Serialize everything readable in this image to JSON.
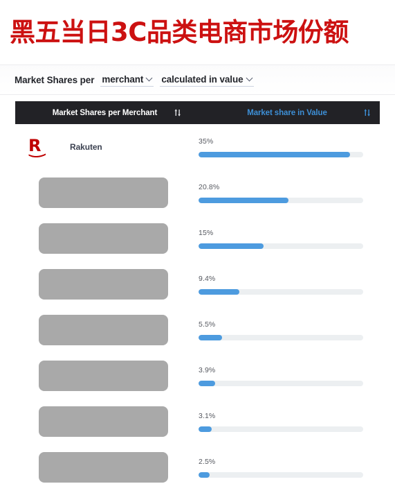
{
  "title": "黑五当日3C品类电商市场份额",
  "title_color": "#cc1111",
  "controls": {
    "prefix_label": "Market Shares per",
    "dimension_dropdown": "merchant",
    "metric_dropdown": "calculated in value"
  },
  "table": {
    "header": {
      "col_merchant": "Market Shares per Merchant",
      "col_value": "Market share in Value",
      "sort_icon": "sort-updown-icon",
      "active_color": "#3d8fd6",
      "background": "#222226"
    },
    "bar_color": "#4d9bdf",
    "bar_track_color": "#eceff1",
    "max_value": 35,
    "rows": [
      {
        "merchant": "Rakuten",
        "logo": "rakuten-r-logo",
        "redacted": false,
        "share": "35%",
        "value": 35.0
      },
      {
        "merchant": "",
        "logo": "",
        "redacted": true,
        "share": "20.8%",
        "value": 20.8
      },
      {
        "merchant": "",
        "logo": "",
        "redacted": true,
        "share": "15%",
        "value": 15.0
      },
      {
        "merchant": "",
        "logo": "",
        "redacted": true,
        "share": "9.4%",
        "value": 9.4
      },
      {
        "merchant": "",
        "logo": "",
        "redacted": true,
        "share": "5.5%",
        "value": 5.5
      },
      {
        "merchant": "",
        "logo": "",
        "redacted": true,
        "share": "3.9%",
        "value": 3.9
      },
      {
        "merchant": "",
        "logo": "",
        "redacted": true,
        "share": "3.1%",
        "value": 3.1
      },
      {
        "merchant": "",
        "logo": "",
        "redacted": true,
        "share": "2.5%",
        "value": 2.5
      }
    ]
  },
  "chart_data": {
    "type": "bar",
    "title": "黑五当日3C品类电商市场份额",
    "subtitle": "Market Shares per merchant calculated in value",
    "xlabel": "Market share in Value",
    "ylabel": "Merchant",
    "categories": [
      "Rakuten",
      "[redacted]",
      "[redacted]",
      "[redacted]",
      "[redacted]",
      "[redacted]",
      "[redacted]",
      "[redacted]"
    ],
    "values": [
      35.0,
      20.8,
      15.0,
      9.4,
      5.5,
      3.9,
      3.1,
      2.5
    ],
    "value_labels": [
      "35%",
      "20.8%",
      "15%",
      "9.4%",
      "5.5%",
      "3.9%",
      "3.1%",
      "2.5%"
    ],
    "unit": "%",
    "xlim": [
      0,
      38
    ],
    "grid": false,
    "legend": "none",
    "orientation": "horizontal"
  }
}
